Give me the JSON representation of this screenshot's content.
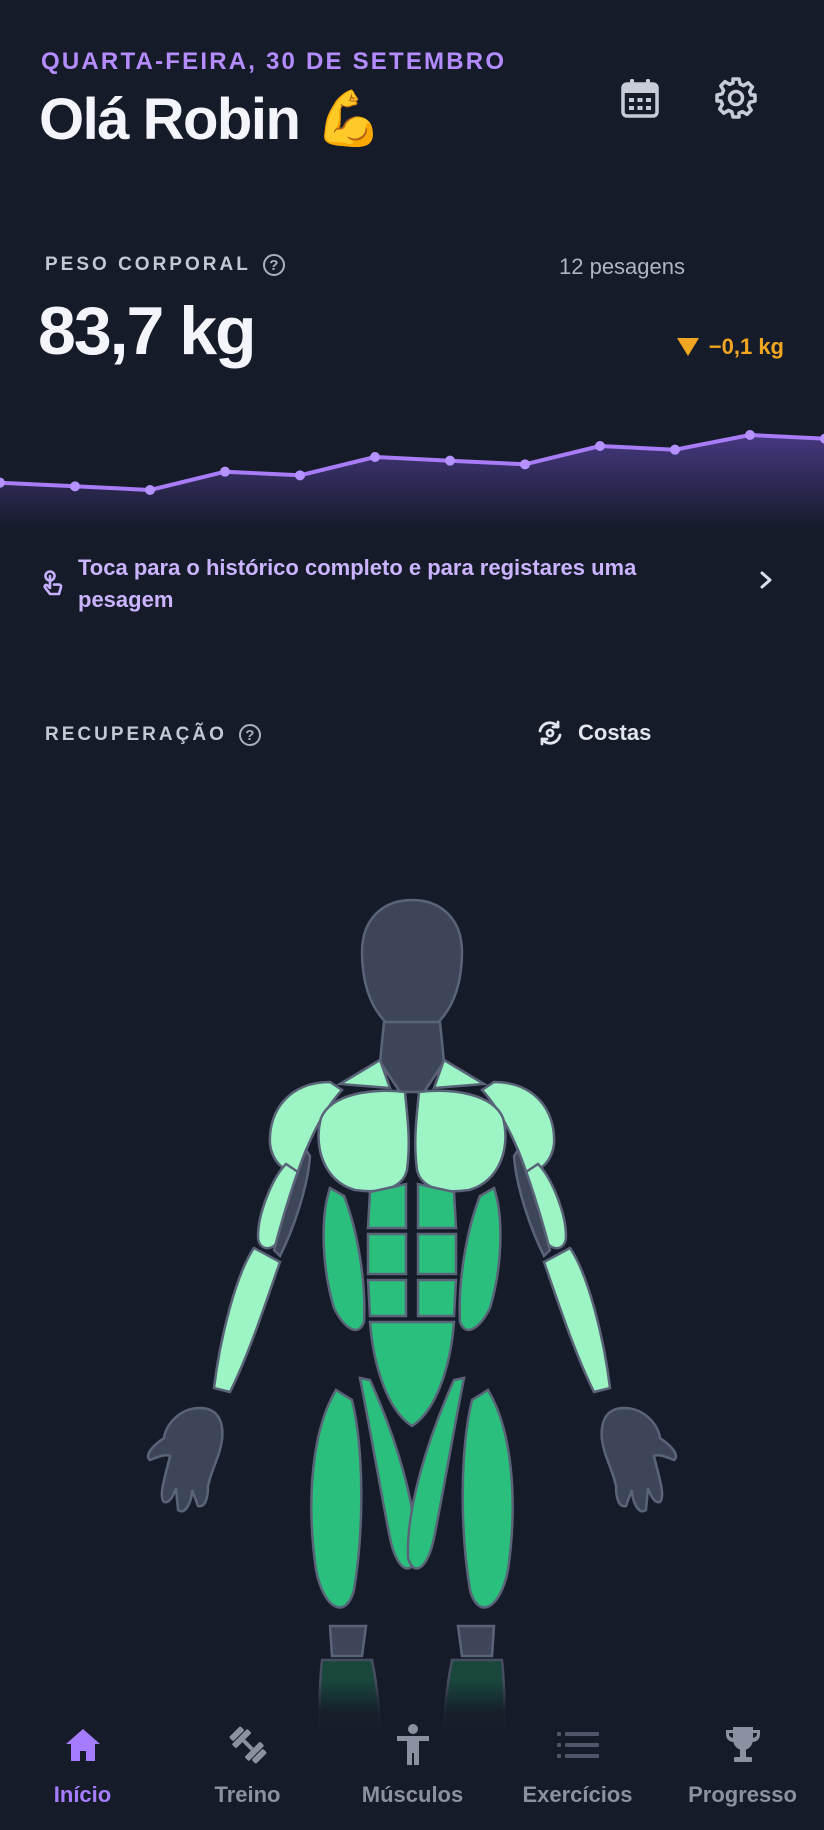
{
  "header": {
    "date": "QUARTA-FEIRA, 30 DE SETEMBRO",
    "greeting": "Olá Robin",
    "greeting_emoji": "💪",
    "calendar_icon": "calendar-icon",
    "settings_icon": "gear-icon"
  },
  "body_weight": {
    "label": "PESO CORPORAL",
    "help": "?",
    "count": "12 pesagens",
    "value": "83,7 kg",
    "delta": "−0,1 kg"
  },
  "chart_data": {
    "type": "line",
    "values": [
      83.3,
      83.25,
      83.2,
      83.45,
      83.4,
      83.65,
      83.6,
      83.55,
      83.8,
      83.75,
      83.95,
      83.9
    ]
  },
  "history_link": {
    "text": "Toca para o histórico completo e para registares uma pesagem",
    "icon": "tap-hand-icon"
  },
  "recovery": {
    "label": "RECUPERAÇÃO",
    "help": "?",
    "toggle_label": "Costas",
    "toggle_icon": "rotate-icon"
  },
  "nav": {
    "tabs": [
      {
        "label": "Início",
        "icon": "home-icon",
        "active": true
      },
      {
        "label": "Treino",
        "icon": "dumbbell-icon",
        "active": false
      },
      {
        "label": "Músculos",
        "icon": "body-icon",
        "active": false
      },
      {
        "label": "Exercícios",
        "icon": "list-icon",
        "active": false
      },
      {
        "label": "Progresso",
        "icon": "trophy-icon",
        "active": false
      }
    ]
  },
  "colors": {
    "accent": "#a67cff",
    "warning": "#f0a620",
    "recovered_light": "#9df5c6",
    "recovered_mid": "#2bbf7e",
    "neutral": "#3d4659"
  }
}
